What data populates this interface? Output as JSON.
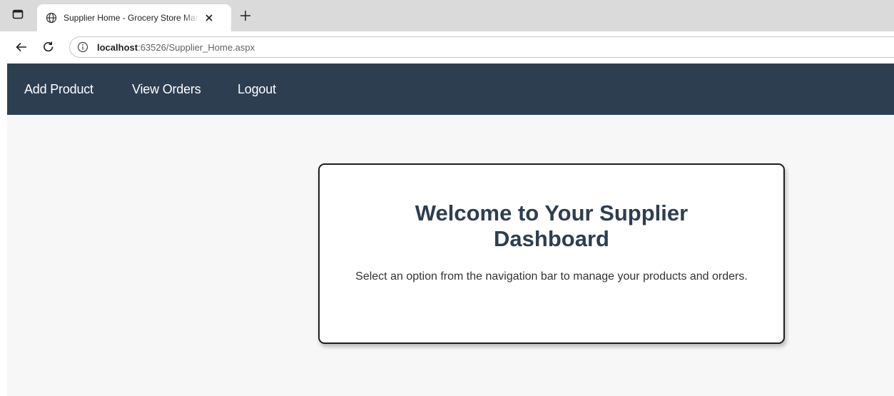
{
  "browser": {
    "tab_title": "Supplier Home - Grocery Store Management",
    "url_host": "localhost",
    "url_rest": ":63526/Supplier_Home.aspx",
    "icons": {
      "sidebar": "sidebar-toggle-icon",
      "tab": "globe-icon",
      "close": "close-icon",
      "new_tab": "plus-icon",
      "back": "back-arrow-icon",
      "reload": "reload-icon",
      "site_info": "info-icon"
    }
  },
  "nav": {
    "items": [
      {
        "label": "Add Product"
      },
      {
        "label": "View Orders"
      },
      {
        "label": "Logout"
      }
    ],
    "background": "#2d3e50"
  },
  "card": {
    "heading": "Welcome to Your Supplier Dashboard",
    "message": "Select an option from the navigation bar to manage your products and orders."
  },
  "colors": {
    "heading": "#2d3e50",
    "page_bg": "#f7f7f7"
  }
}
